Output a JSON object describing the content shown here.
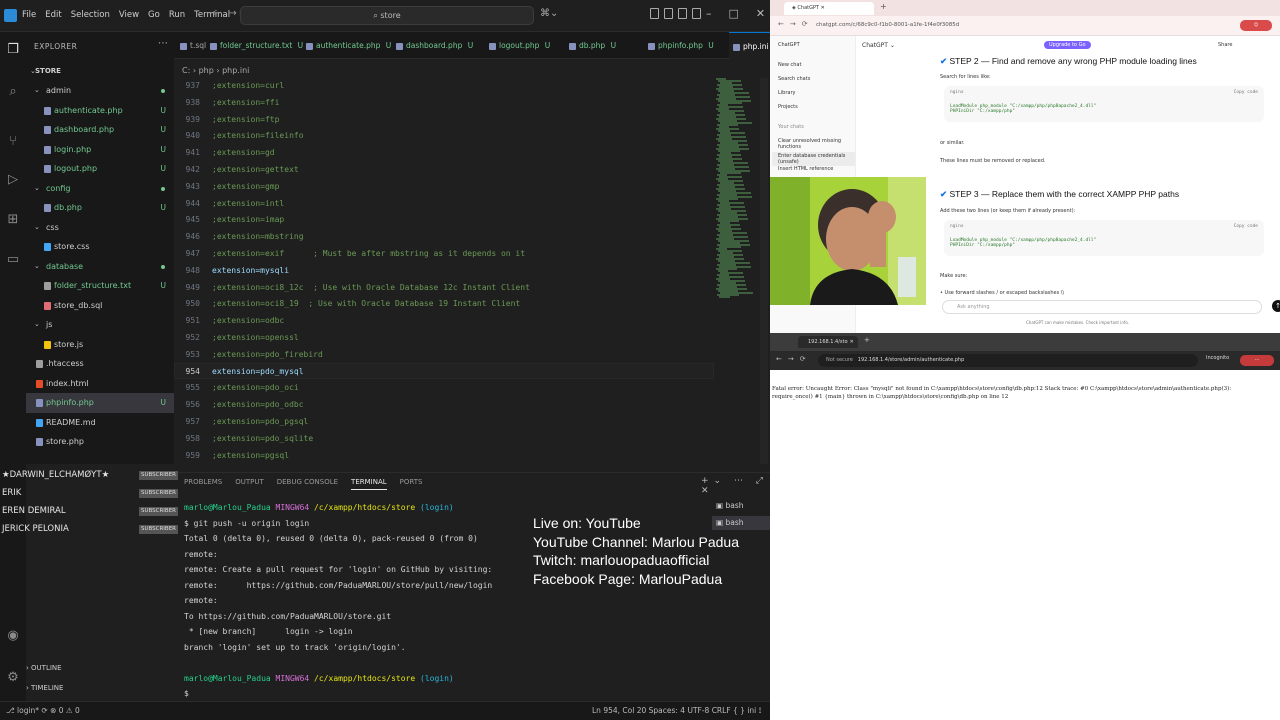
{
  "vscode": {
    "menu": [
      "File",
      "Edit",
      "Selection",
      "View",
      "Go",
      "Run",
      "Terminal",
      "Help"
    ],
    "search": "store",
    "explorer_title": "EXPLORER",
    "root_folder": "STORE",
    "tree": [
      {
        "name": "admin",
        "kind": "folder",
        "depth": 1,
        "open": true,
        "badge": "dot",
        "color": "#cfcfcf"
      },
      {
        "name": "authenticate.php",
        "kind": "php",
        "depth": 2,
        "badge": "U",
        "color": "#73c991"
      },
      {
        "name": "dashboard.php",
        "kind": "php",
        "depth": 2,
        "badge": "U",
        "color": "#73c991"
      },
      {
        "name": "login.php",
        "kind": "php",
        "depth": 2,
        "badge": "U",
        "color": "#73c991"
      },
      {
        "name": "logout.php",
        "kind": "php",
        "depth": 2,
        "badge": "U",
        "color": "#73c991"
      },
      {
        "name": "config",
        "kind": "folder",
        "depth": 1,
        "open": true,
        "badge": "dot",
        "color": "#73c991"
      },
      {
        "name": "db.php",
        "kind": "php",
        "depth": 2,
        "badge": "U",
        "color": "#73c991"
      },
      {
        "name": "css",
        "kind": "folder",
        "depth": 1,
        "open": true,
        "badge": "",
        "color": "#cfcfcf"
      },
      {
        "name": "store.css",
        "kind": "css",
        "depth": 2,
        "badge": "",
        "color": "#cfcfcf"
      },
      {
        "name": "database",
        "kind": "folder",
        "depth": 1,
        "open": true,
        "badge": "dot",
        "color": "#73c991"
      },
      {
        "name": "folder_structure.txt",
        "kind": "txt",
        "depth": 2,
        "badge": "U",
        "color": "#73c991"
      },
      {
        "name": "store_db.sql",
        "kind": "sql",
        "depth": 2,
        "badge": "",
        "color": "#cfcfcf"
      },
      {
        "name": "js",
        "kind": "folder",
        "depth": 1,
        "open": true,
        "badge": "",
        "color": "#cfcfcf"
      },
      {
        "name": "store.js",
        "kind": "js",
        "depth": 2,
        "badge": "",
        "color": "#cfcfcf"
      },
      {
        "name": ".htaccess",
        "kind": "cfg",
        "depth": 1,
        "badge": "",
        "color": "#cfcfcf"
      },
      {
        "name": "index.html",
        "kind": "html",
        "depth": 1,
        "badge": "",
        "color": "#cfcfcf"
      },
      {
        "name": "phpinfo.php",
        "kind": "php",
        "depth": 1,
        "badge": "U",
        "color": "#73c991",
        "selected": true
      },
      {
        "name": "README.md",
        "kind": "md",
        "depth": 1,
        "badge": "",
        "color": "#cfcfcf"
      },
      {
        "name": "store.php",
        "kind": "php",
        "depth": 1,
        "badge": "",
        "color": "#cfcfcf"
      }
    ],
    "tabs": [
      {
        "label": "t.sql",
        "state": ""
      },
      {
        "label": "folder_structure.txt",
        "state": "U"
      },
      {
        "label": "authenticate.php",
        "state": "U"
      },
      {
        "label": "dashboard.php",
        "state": "U"
      },
      {
        "label": "logout.php",
        "state": "U"
      },
      {
        "label": "db.php",
        "state": "U"
      },
      {
        "label": "phpinfo.php",
        "state": "U"
      },
      {
        "label": "php.ini",
        "state": "X",
        "active": true
      }
    ],
    "breadcrumb": "C: › php › php.ini",
    "code_lines": [
      {
        "n": "937",
        "t": ";extension=curl"
      },
      {
        "n": "938",
        "t": ";extension=ffi"
      },
      {
        "n": "939",
        "t": ";extension=ftp"
      },
      {
        "n": "940",
        "t": ";extension=fileinfo"
      },
      {
        "n": "941",
        "t": ";extension=gd"
      },
      {
        "n": "942",
        "t": ";extension=gettext"
      },
      {
        "n": "943",
        "t": ";extension=gmp"
      },
      {
        "n": "944",
        "t": ";extension=intl"
      },
      {
        "n": "945",
        "t": ";extension=imap"
      },
      {
        "n": "946",
        "t": ";extension=mbstring"
      },
      {
        "n": "947",
        "t": ";extension=exif      ; Must be after mbstring as it depends on it"
      },
      {
        "n": "948",
        "t": "extension=mysqli",
        "active": true
      },
      {
        "n": "949",
        "t": ";extension=oci8_12c  ; Use with Oracle Database 12c Instant Client"
      },
      {
        "n": "950",
        "t": ";extension=oci8_19  ; Use with Oracle Database 19 Instant Client"
      },
      {
        "n": "951",
        "t": ";extension=odbc"
      },
      {
        "n": "952",
        "t": ";extension=openssl"
      },
      {
        "n": "953",
        "t": ";extension=pdo_firebird"
      },
      {
        "n": "954",
        "t": "extension=pdo_mysql",
        "active": true,
        "current": true
      },
      {
        "n": "955",
        "t": ";extension=pdo_oci"
      },
      {
        "n": "956",
        "t": ";extension=pdo_odbc"
      },
      {
        "n": "957",
        "t": ";extension=pdo_pgsql"
      },
      {
        "n": "958",
        "t": ";extension=pdo_sqlite"
      },
      {
        "n": "959",
        "t": ";extension=pgsql"
      }
    ],
    "panel_tabs": [
      "PROBLEMS",
      "OUTPUT",
      "DEBUG CONSOLE",
      "TERMINAL",
      "PORTS"
    ],
    "terminal": [
      {
        "parts": [
          [
            "marlo@Marlou_Padua ",
            "t-green"
          ],
          [
            "MINGW64 ",
            "t-purple"
          ],
          [
            "/c/xampp/htdocs/store ",
            "t-yellow"
          ],
          [
            "(login)",
            "t-cyan"
          ]
        ]
      },
      {
        "parts": [
          [
            "$ git push -u origin login",
            ""
          ]
        ]
      },
      {
        "parts": [
          [
            "Total 0 (delta 0), reused 0 (delta 0), pack-reused 0 (from 0)",
            ""
          ]
        ]
      },
      {
        "parts": [
          [
            "remote:",
            ""
          ]
        ]
      },
      {
        "parts": [
          [
            "remote: Create a pull request for 'login' on GitHub by visiting:",
            ""
          ]
        ]
      },
      {
        "parts": [
          [
            "remote:      https://github.com/PaduaMARLOU/store/pull/new/login",
            ""
          ]
        ]
      },
      {
        "parts": [
          [
            "remote:",
            ""
          ]
        ]
      },
      {
        "parts": [
          [
            "To https://github.com/PaduaMARLOU/store.git",
            ""
          ]
        ]
      },
      {
        "parts": [
          [
            " * [new branch]      login -> login",
            ""
          ]
        ]
      },
      {
        "parts": [
          [
            "branch 'login' set up to track 'origin/login'.",
            ""
          ]
        ]
      },
      {
        "parts": [
          [
            "",
            ""
          ]
        ]
      },
      {
        "parts": [
          [
            "marlo@Marlou_Padua ",
            "t-green"
          ],
          [
            "MINGW64 ",
            "t-purple"
          ],
          [
            "/c/xampp/htdocs/store ",
            "t-yellow"
          ],
          [
            "(login)",
            "t-cyan"
          ]
        ]
      },
      {
        "parts": [
          [
            "$ ",
            ""
          ]
        ]
      }
    ],
    "bash_sessions": [
      "bash",
      "bash"
    ],
    "outline": "OUTLINE",
    "timeline": "TIMELINE",
    "status_left": "⎇ login*  ⟳  ⊗ 0 ⚠ 0",
    "status_right": "Ln 954, Col 20   Spaces: 4   UTF-8   CRLF   { } ini   ⟟"
  },
  "stream_overlay": {
    "chatters": [
      {
        "name": "★DARWIN_ELCHAMØYT★",
        "tag": "SUBSCRIBER"
      },
      {
        "name": "ERIK",
        "tag": "SUBSCRIBER"
      },
      {
        "name": "EREN DEMIRAL",
        "tag": "SUBSCRIBER"
      },
      {
        "name": "JERICK PELONIA",
        "tag": "SUBSCRIBER"
      }
    ],
    "live_lines": [
      "Live on: YouTube",
      "YouTube Channel: Marlou Padua",
      "Twitch: marlouopaduaofficial",
      "Facebook Page: MarlouPadua"
    ]
  },
  "chatgpt": {
    "url": "chatgpt.com/c/68c9c0-f1b0-8001-a1fe-1f4e0f3085d",
    "side_items": [
      "ChatGPT",
      "New chat",
      "Search chats",
      "Library",
      "Projects",
      "Your chats",
      "Clear unresolved missing functions",
      "Enter database credentials (unsafe)",
      "Insert HTML reference"
    ],
    "model": "ChatGPT ⌄",
    "upgrade": "Upgrade to Go",
    "share": "Share",
    "step2": "STEP 2 — Find and remove any wrong PHP module loading lines",
    "step2_sub": "Search for lines like:",
    "code1_lang": "nginx",
    "copy": "Copy code",
    "code1": "LoadModule php_module \"C:/xampp/php/php8apache2_4.dll\"\nPHPIniDir \"C:/xampp/php\"",
    "or_similar": "or similar.",
    "these_lines": "These lines must be removed or replaced.",
    "step3": "STEP 3 — Replace them with the correct XAMPP PHP paths",
    "step3_sub": "Add these two lines (or keep them if already present):",
    "code2": "LoadModule php_module \"C:/xampp/php/php8apache2_4.dll\"\nPHPIniDir \"C:/xampp/php\"",
    "make_sure": "Make sure:",
    "bullet": "• Use forward slashes / or escaped backslashes \\\\",
    "ask": "Ask anything",
    "disclaimer": "ChatGPT can make mistakes. Check important info."
  },
  "browser2": {
    "tab": "192.168.1.4/store/admin/authenticate.php",
    "notsecure": "Not secure",
    "url": "192.168.1.4/store/admin/authenticate.php",
    "incognito": "Incognito",
    "error": "Fatal error: Uncaught Error: Class \"mysqli\" not found in C:\\xampp\\htdocs\\store\\config\\db.php:12 Stack trace: #0 C:\\xampp\\htdocs\\store\\admin\\authenticate.php(3): require_once() #1 {main} thrown in C:\\xampp\\htdocs\\store\\config\\db.php on line 12"
  }
}
